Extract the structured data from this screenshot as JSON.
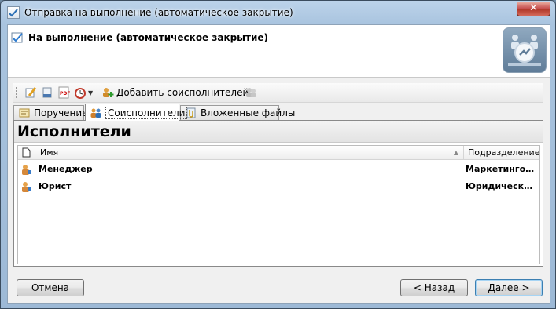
{
  "window": {
    "title": "Отправка на выполнение (автоматическое закрытие)",
    "close_label": "✕"
  },
  "header": {
    "title": "На выполнение (автоматическое закрытие)"
  },
  "toolbar": {
    "add_coexecutors_label": "Добавить соисполнителей"
  },
  "tabs": [
    {
      "label": "Поручение",
      "icon": "assignment-icon"
    },
    {
      "label": "Соисполнители",
      "icon": "people-icon",
      "active": true
    },
    {
      "label": "Вложенные файлы",
      "icon": "attachment-icon"
    }
  ],
  "panel": {
    "title": "Исполнители"
  },
  "grid": {
    "columns": [
      "Имя",
      "Подразделение"
    ],
    "rows": [
      {
        "name": "Менеджер",
        "department": "Маркетинговый отдел"
      },
      {
        "name": "Юрист",
        "department": "Юридический отдел"
      }
    ]
  },
  "footer": {
    "cancel_label": "Отмена",
    "back_label": "< Назад",
    "next_label": "Далее >"
  }
}
